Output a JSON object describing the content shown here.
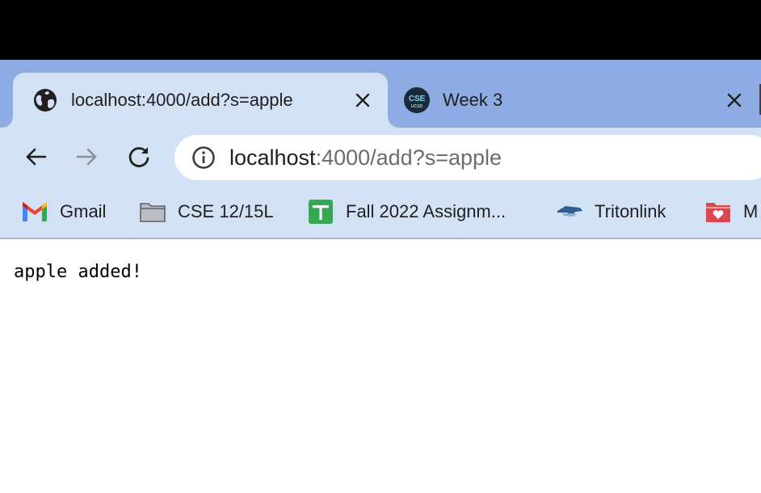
{
  "tabs": [
    {
      "title": "localhost:4000/add?s=apple",
      "favicon": "globe-icon",
      "active": true
    },
    {
      "title": "Week 3",
      "favicon": "cse-ucsd-logo",
      "active": false
    }
  ],
  "tab_favicon_text": {
    "top": "CSE",
    "bottom": "UCSD"
  },
  "address_bar": {
    "host": "localhost",
    "rest": ":4000/add?s=apple",
    "info_icon": "info-icon"
  },
  "nav": {
    "back": "back-arrow-icon",
    "forward": "forward-arrow-icon",
    "reload": "reload-icon"
  },
  "bookmarks": [
    {
      "label": "Gmail",
      "icon": "gmail-icon"
    },
    {
      "label": "CSE 12/15L",
      "icon": "folder-icon"
    },
    {
      "label": "Fall 2022 Assignm...",
      "icon": "sheets-icon"
    },
    {
      "label": "Tritonlink",
      "icon": "tritonlink-icon"
    },
    {
      "label": "M",
      "icon": "red-folder-icon"
    }
  ],
  "page": {
    "message": "apple added!"
  },
  "colors": {
    "tabstrip": "#8eabe3",
    "active_tab": "#d3e1f5",
    "toolbar": "#d3e1f5",
    "url_muted": "#6b6b6b"
  }
}
